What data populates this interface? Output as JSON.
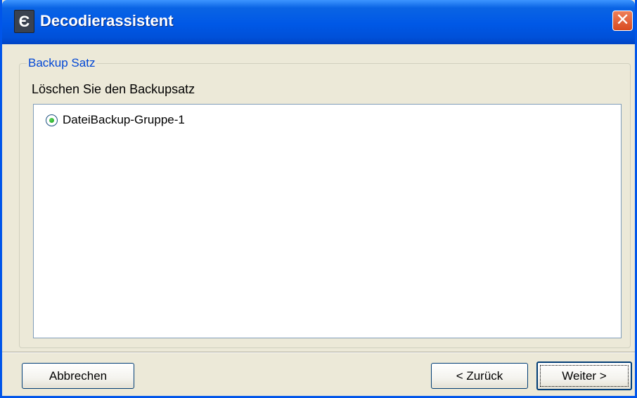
{
  "window": {
    "title": "Decodierassistent",
    "icon": "app-logo-icon",
    "icon_glyph": "Є",
    "close_glyph": "✕"
  },
  "group": {
    "legend": "Backup Satz",
    "instruction": "Löschen Sie den Backupsatz",
    "options": [
      {
        "label": "DateiBackup-Gruppe-1",
        "selected": true
      }
    ]
  },
  "buttons": {
    "cancel": "Abbrechen",
    "back": "< Zurück",
    "next": "Weiter >"
  },
  "colors": {
    "titlebar": "#0058e6",
    "window_bg": "#ece9d8",
    "legend_text": "#0046d5",
    "close_button": "#d84a20",
    "radio_dot": "#21a121"
  }
}
